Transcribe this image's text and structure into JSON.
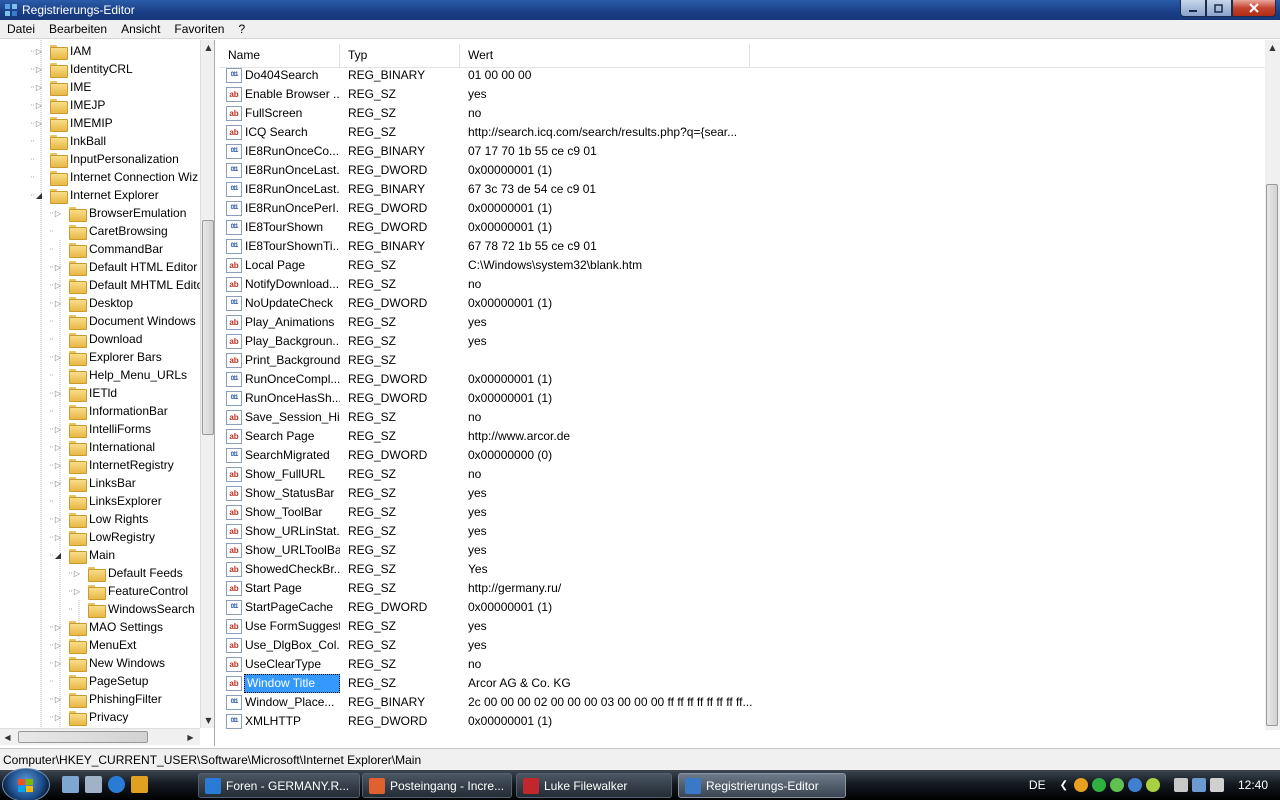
{
  "window": {
    "title": "Registrierungs-Editor"
  },
  "menu": [
    "Datei",
    "Bearbeiten",
    "Ansicht",
    "Favoriten",
    "?"
  ],
  "tree": {
    "items": [
      {
        "label": "IAM",
        "level": 1,
        "expander": "collapsed"
      },
      {
        "label": "IdentityCRL",
        "level": 1,
        "expander": "collapsed"
      },
      {
        "label": "IME",
        "level": 1,
        "expander": "collapsed"
      },
      {
        "label": "IMEJP",
        "level": 1,
        "expander": "collapsed"
      },
      {
        "label": "IMEMIP",
        "level": 1,
        "expander": "collapsed"
      },
      {
        "label": "InkBall",
        "level": 1,
        "expander": "none"
      },
      {
        "label": "InputPersonalization",
        "level": 1,
        "expander": "none"
      },
      {
        "label": "Internet Connection Wiz",
        "level": 1,
        "expander": "none"
      },
      {
        "label": "Internet Explorer",
        "level": 1,
        "expander": "expanded"
      },
      {
        "label": "BrowserEmulation",
        "level": 2,
        "expander": "collapsed"
      },
      {
        "label": "CaretBrowsing",
        "level": 2,
        "expander": "none"
      },
      {
        "label": "CommandBar",
        "level": 2,
        "expander": "none"
      },
      {
        "label": "Default HTML Editor",
        "level": 2,
        "expander": "collapsed"
      },
      {
        "label": "Default MHTML Edito",
        "level": 2,
        "expander": "collapsed"
      },
      {
        "label": "Desktop",
        "level": 2,
        "expander": "collapsed"
      },
      {
        "label": "Document Windows",
        "level": 2,
        "expander": "none"
      },
      {
        "label": "Download",
        "level": 2,
        "expander": "none"
      },
      {
        "label": "Explorer Bars",
        "level": 2,
        "expander": "collapsed"
      },
      {
        "label": "Help_Menu_URLs",
        "level": 2,
        "expander": "none"
      },
      {
        "label": "IETld",
        "level": 2,
        "expander": "collapsed"
      },
      {
        "label": "InformationBar",
        "level": 2,
        "expander": "none"
      },
      {
        "label": "IntelliForms",
        "level": 2,
        "expander": "collapsed"
      },
      {
        "label": "International",
        "level": 2,
        "expander": "collapsed"
      },
      {
        "label": "InternetRegistry",
        "level": 2,
        "expander": "collapsed"
      },
      {
        "label": "LinksBar",
        "level": 2,
        "expander": "collapsed"
      },
      {
        "label": "LinksExplorer",
        "level": 2,
        "expander": "none"
      },
      {
        "label": "Low Rights",
        "level": 2,
        "expander": "collapsed"
      },
      {
        "label": "LowRegistry",
        "level": 2,
        "expander": "collapsed"
      },
      {
        "label": "Main",
        "level": 2,
        "expander": "expanded"
      },
      {
        "label": "Default Feeds",
        "level": 3,
        "expander": "collapsed"
      },
      {
        "label": "FeatureControl",
        "level": 3,
        "expander": "collapsed"
      },
      {
        "label": "WindowsSearch",
        "level": 3,
        "expander": "none"
      },
      {
        "label": "MAO Settings",
        "level": 2,
        "expander": "collapsed"
      },
      {
        "label": "MenuExt",
        "level": 2,
        "expander": "collapsed"
      },
      {
        "label": "New Windows",
        "level": 2,
        "expander": "collapsed"
      },
      {
        "label": "PageSetup",
        "level": 2,
        "expander": "none"
      },
      {
        "label": "PhishingFilter",
        "level": 2,
        "expander": "collapsed"
      },
      {
        "label": "Privacy",
        "level": 2,
        "expander": "collapsed"
      }
    ]
  },
  "columns": {
    "name": "Name",
    "type": "Typ",
    "value": "Wert"
  },
  "values": [
    {
      "name": "Do404Search",
      "type": "REG_BINARY",
      "value": "01 00 00 00",
      "icon": "binary"
    },
    {
      "name": "Enable Browser ...",
      "type": "REG_SZ",
      "value": "yes",
      "icon": "string"
    },
    {
      "name": "FullScreen",
      "type": "REG_SZ",
      "value": "no",
      "icon": "string"
    },
    {
      "name": "ICQ Search",
      "type": "REG_SZ",
      "value": "http://search.icq.com/search/results.php?q={sear...",
      "icon": "string"
    },
    {
      "name": "IE8RunOnceCo...",
      "type": "REG_BINARY",
      "value": "07 17 70 1b 55 ce c9 01",
      "icon": "binary"
    },
    {
      "name": "IE8RunOnceLast...",
      "type": "REG_DWORD",
      "value": "0x00000001 (1)",
      "icon": "binary"
    },
    {
      "name": "IE8RunOnceLast...",
      "type": "REG_BINARY",
      "value": "67 3c 73 de 54 ce c9 01",
      "icon": "binary"
    },
    {
      "name": "IE8RunOncePerI...",
      "type": "REG_DWORD",
      "value": "0x00000001 (1)",
      "icon": "binary"
    },
    {
      "name": "IE8TourShown",
      "type": "REG_DWORD",
      "value": "0x00000001 (1)",
      "icon": "binary"
    },
    {
      "name": "IE8TourShownTi...",
      "type": "REG_BINARY",
      "value": "67 78 72 1b 55 ce c9 01",
      "icon": "binary"
    },
    {
      "name": "Local Page",
      "type": "REG_SZ",
      "value": "C:\\Windows\\system32\\blank.htm",
      "icon": "string"
    },
    {
      "name": "NotifyDownload...",
      "type": "REG_SZ",
      "value": "no",
      "icon": "string"
    },
    {
      "name": "NoUpdateCheck",
      "type": "REG_DWORD",
      "value": "0x00000001 (1)",
      "icon": "binary"
    },
    {
      "name": "Play_Animations",
      "type": "REG_SZ",
      "value": "yes",
      "icon": "string"
    },
    {
      "name": "Play_Backgroun...",
      "type": "REG_SZ",
      "value": "yes",
      "icon": "string"
    },
    {
      "name": "Print_Background",
      "type": "REG_SZ",
      "value": "",
      "icon": "string"
    },
    {
      "name": "RunOnceCompl...",
      "type": "REG_DWORD",
      "value": "0x00000001 (1)",
      "icon": "binary"
    },
    {
      "name": "RunOnceHasSh...",
      "type": "REG_DWORD",
      "value": "0x00000001 (1)",
      "icon": "binary"
    },
    {
      "name": "Save_Session_Hi...",
      "type": "REG_SZ",
      "value": "no",
      "icon": "string"
    },
    {
      "name": "Search Page",
      "type": "REG_SZ",
      "value": "http://www.arcor.de",
      "icon": "string"
    },
    {
      "name": "SearchMigrated",
      "type": "REG_DWORD",
      "value": "0x00000000 (0)",
      "icon": "binary"
    },
    {
      "name": "Show_FullURL",
      "type": "REG_SZ",
      "value": "no",
      "icon": "string"
    },
    {
      "name": "Show_StatusBar",
      "type": "REG_SZ",
      "value": "yes",
      "icon": "string"
    },
    {
      "name": "Show_ToolBar",
      "type": "REG_SZ",
      "value": "yes",
      "icon": "string"
    },
    {
      "name": "Show_URLinStat...",
      "type": "REG_SZ",
      "value": "yes",
      "icon": "string"
    },
    {
      "name": "Show_URLToolBar",
      "type": "REG_SZ",
      "value": "yes",
      "icon": "string"
    },
    {
      "name": "ShowedCheckBr...",
      "type": "REG_SZ",
      "value": "Yes",
      "icon": "string"
    },
    {
      "name": "Start Page",
      "type": "REG_SZ",
      "value": "http://germany.ru/",
      "icon": "string"
    },
    {
      "name": "StartPageCache",
      "type": "REG_DWORD",
      "value": "0x00000001 (1)",
      "icon": "binary"
    },
    {
      "name": "Use FormSuggest",
      "type": "REG_SZ",
      "value": "yes",
      "icon": "string"
    },
    {
      "name": "Use_DlgBox_Col...",
      "type": "REG_SZ",
      "value": "yes",
      "icon": "string"
    },
    {
      "name": "UseClearType",
      "type": "REG_SZ",
      "value": "no",
      "icon": "string"
    },
    {
      "name": "Window Title",
      "type": "REG_SZ",
      "value": "Arcor AG & Co. KG",
      "icon": "string",
      "selected": true
    },
    {
      "name": "Window_Place...",
      "type": "REG_BINARY",
      "value": "2c 00 00 00 02 00 00 00 03 00 00 00 ff ff ff ff ff ff ff ff...",
      "icon": "binary"
    },
    {
      "name": "XMLHTTP",
      "type": "REG_DWORD",
      "value": "0x00000001 (1)",
      "icon": "binary"
    }
  ],
  "statusbar": {
    "path": "Computer\\HKEY_CURRENT_USER\\Software\\Microsoft\\Internet Explorer\\Main"
  },
  "taskbar": {
    "buttons": [
      {
        "label": "Foren - GERMANY.R...",
        "icon": "ie-icon",
        "color": "#2a7bd6",
        "active": false
      },
      {
        "label": "Posteingang - Incre...",
        "icon": "mail-icon",
        "color": "#e06030",
        "active": false
      },
      {
        "label": "Luke Filewalker",
        "icon": "winrar-icon",
        "color": "#c0282c",
        "active": false
      },
      {
        "label": "Registrierungs-Editor",
        "icon": "regedit-icon",
        "color": "#3a78c8",
        "active": true
      }
    ],
    "language": "DE",
    "clock": "12:40"
  }
}
